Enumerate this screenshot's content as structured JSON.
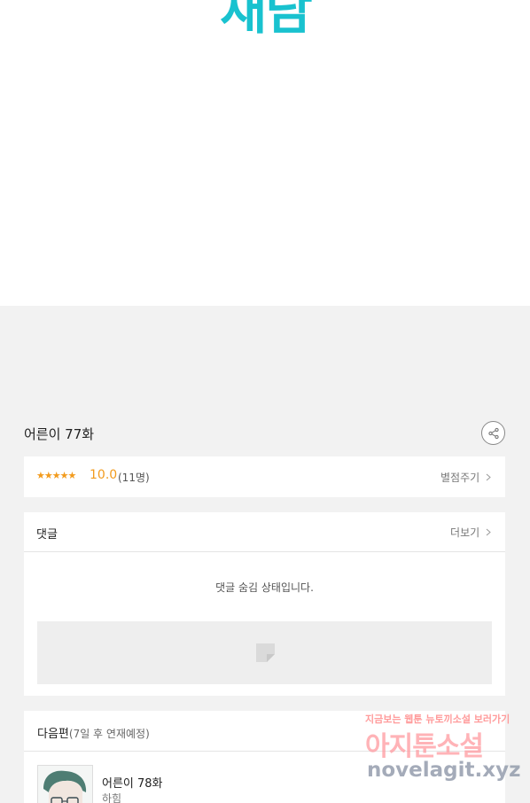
{
  "top": {
    "logo_text": "재담"
  },
  "episode": {
    "title": "어른이 77화"
  },
  "rating": {
    "stars": "★★★★★",
    "score": "10.0",
    "count": "(11명)",
    "rate_link": "별점주기"
  },
  "comments": {
    "title": "댓글",
    "more_link": "더보기",
    "hidden_message": "댓글 숨김 상태입니다."
  },
  "next_episode": {
    "label": "다음편",
    "schedule": "(7일 후 연재예정)",
    "title": "어른이 78화",
    "author": "하힘"
  },
  "watermark": {
    "top": "지금보는 웹툰 뉴토끼소설 보러가기",
    "main": "아지툰소설",
    "url": "novelagit.xyz"
  },
  "colors": {
    "accent": "#19c2cf",
    "star": "#f29b1d",
    "background": "#f2f2f2"
  },
  "icons": [
    "share-icon",
    "chevron-right-icon",
    "ad-placeholder-icon"
  ]
}
